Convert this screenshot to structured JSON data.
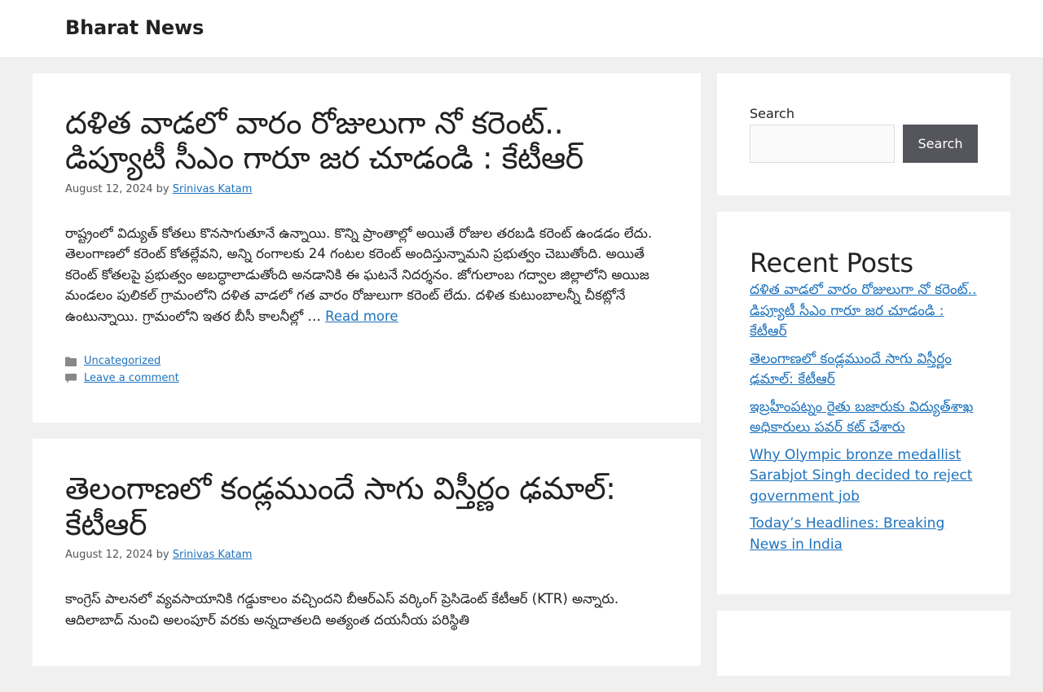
{
  "header": {
    "site_title": "Bharat News"
  },
  "posts": [
    {
      "title": "దళిత వాడలో వారం రోజులుగా నో కరెంట్.. డిప్యూటీ సీఎం గారూ జర చూడండి : కేటీఆర్",
      "date": "August 12, 2024",
      "by": "by",
      "author": "Srinivas Katam",
      "excerpt": "రాష్ట్రంలో విద్యుత్ కోతలు కొనసాగుతూనే ఉన్నాయి. కొన్ని ప్రాంతాల్లో అయితే రోజుల తరబడి కరెంట్ ఉండడం లేదు. తెలంగాణలో కరెంట్ కోతల్లేవని, అన్ని రంగాలకు 24 గంటల కరెంట్ అందిస్తున్నామని ప్రభుత్వం చెబుతోంది. అయితే కరెంట్ కోతలపై ప్రభుత్వం అబద్ధాలాడుతోంది అనడానికి ఈ ఘటనే నిదర్శనం. జోగులాంబ గద్వాల జిల్లాలోని అయిజ మండలం పులికల్ గ్రామంలోని దళిత వాడలో గత వారం రోజులుగా కరెంట్ లేదు. దళిత కుటుంబాలన్నీ చీకట్లోనే ఉంటున్నాయి. గ్రామంలోని ఇతర బీసీ కాలనీల్లో …",
      "read_more": "Read more",
      "category": "Uncategorized",
      "comment": "Leave a comment"
    },
    {
      "title": "తెలంగాణలో కండ్లముందే సాగు విస్తీర్ణం ఢమాల్: కేటీఆర్",
      "date": "August 12, 2024",
      "by": "by",
      "author": "Srinivas Katam",
      "excerpt": "కాంగ్రెస్ పాలనలో వ్యవసాయానికి గడ్డుకాలం వచ్చిందని బీఆర్ఎస్ వర్కింగ్ ప్రెసిడెంట్ కేటీఆర్ (KTR) అన్నారు. ఆదిలాబాద్ నుంచి అలంపూర్ వరకు అన్నదాతలది అత్యంత దయనీయ పరిస్థితి"
    }
  ],
  "sidebar": {
    "search_label": "Search",
    "search_button": "Search",
    "recent_title": "Recent Posts",
    "recent_posts": [
      "దళిత వాడలో వారం రోజులుగా నో కరెంట్.. డిప్యూటీ సీఎం గారూ జర చూడండి : కేటీఆర్",
      "తెలంగాణలో కండ్లముందే సాగు విస్తీర్ణం ఢమాల్: కేటీఆర్",
      "ఇబ్రహీంపట్నం రైతు బజారుకు విద్యుత్‌శాఖ అధికారులు పవర్ కట్ చేశారు",
      "Why Olympic bronze medallist Sarabjot Singh decided to reject government job",
      "Today’s Headlines: Breaking News in India"
    ]
  }
}
